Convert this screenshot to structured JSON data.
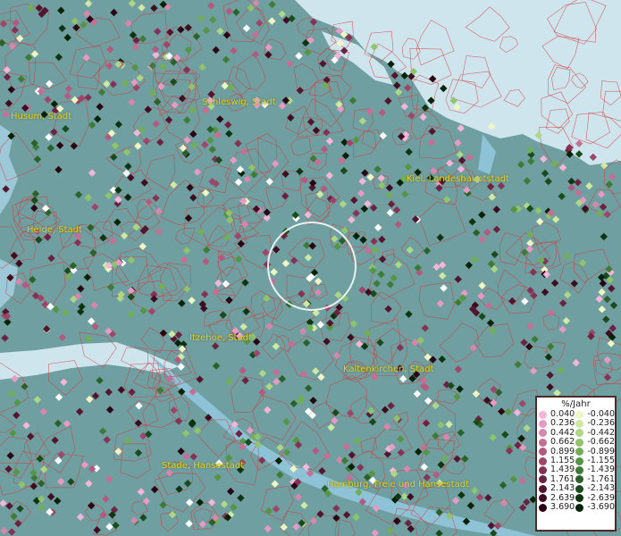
{
  "map": {
    "labels": [
      {
        "id": "husum",
        "text": "Husum, Stadt"
      },
      {
        "id": "schleswig",
        "text": "Schleswig, Stadt"
      },
      {
        "id": "kiel",
        "text": "Kiel, Landeshauptstadt"
      },
      {
        "id": "heide",
        "text": "Heide, Stadt"
      },
      {
        "id": "itzehoe",
        "text": "Itzehoe, Stadt"
      },
      {
        "id": "kaltenkirchen",
        "text": "Kaltenkirchen, Stadt"
      },
      {
        "id": "stade",
        "text": "Stade, Hansestadt"
      },
      {
        "id": "hamburg",
        "text": "Hamburg, Freie und Hansestadt"
      }
    ],
    "colors": {
      "land": "#6f9fa0",
      "water": "#cfe5ee",
      "borders": "#d23a3a",
      "label": "#e6d21c",
      "selection_ring": "#ffffff"
    }
  },
  "legend": {
    "title": "%/Jahr",
    "positive": [
      {
        "value": "0.040",
        "color": "#f4b6d8"
      },
      {
        "value": "0.236",
        "color": "#e79ac3"
      },
      {
        "value": "0.442",
        "color": "#d786ad"
      },
      {
        "value": "0.662",
        "color": "#c66e96"
      },
      {
        "value": "0.899",
        "color": "#b25a80"
      },
      {
        "value": "1.155",
        "color": "#9d4669"
      },
      {
        "value": "1.439",
        "color": "#853355"
      },
      {
        "value": "1.761",
        "color": "#6c2341"
      },
      {
        "value": "2.143",
        "color": "#54162f"
      },
      {
        "value": "2.639",
        "color": "#3e0d20"
      },
      {
        "value": "3.690",
        "color": "#290611"
      }
    ],
    "negative": [
      {
        "value": "-0.040",
        "color": "#eef6c4"
      },
      {
        "value": "-0.236",
        "color": "#cde9a2"
      },
      {
        "value": "-0.442",
        "color": "#aed785"
      },
      {
        "value": "-0.662",
        "color": "#8fc46b"
      },
      {
        "value": "-0.899",
        "color": "#72ae57"
      },
      {
        "value": "-1.155",
        "color": "#569546"
      },
      {
        "value": "-1.439",
        "color": "#3e7b37"
      },
      {
        "value": "-1.761",
        "color": "#2a6229"
      },
      {
        "value": "-2.143",
        "color": "#1a4b1c"
      },
      {
        "value": "-2.639",
        "color": "#0e3511"
      },
      {
        "value": "-3.690",
        "color": "#062207"
      }
    ]
  }
}
